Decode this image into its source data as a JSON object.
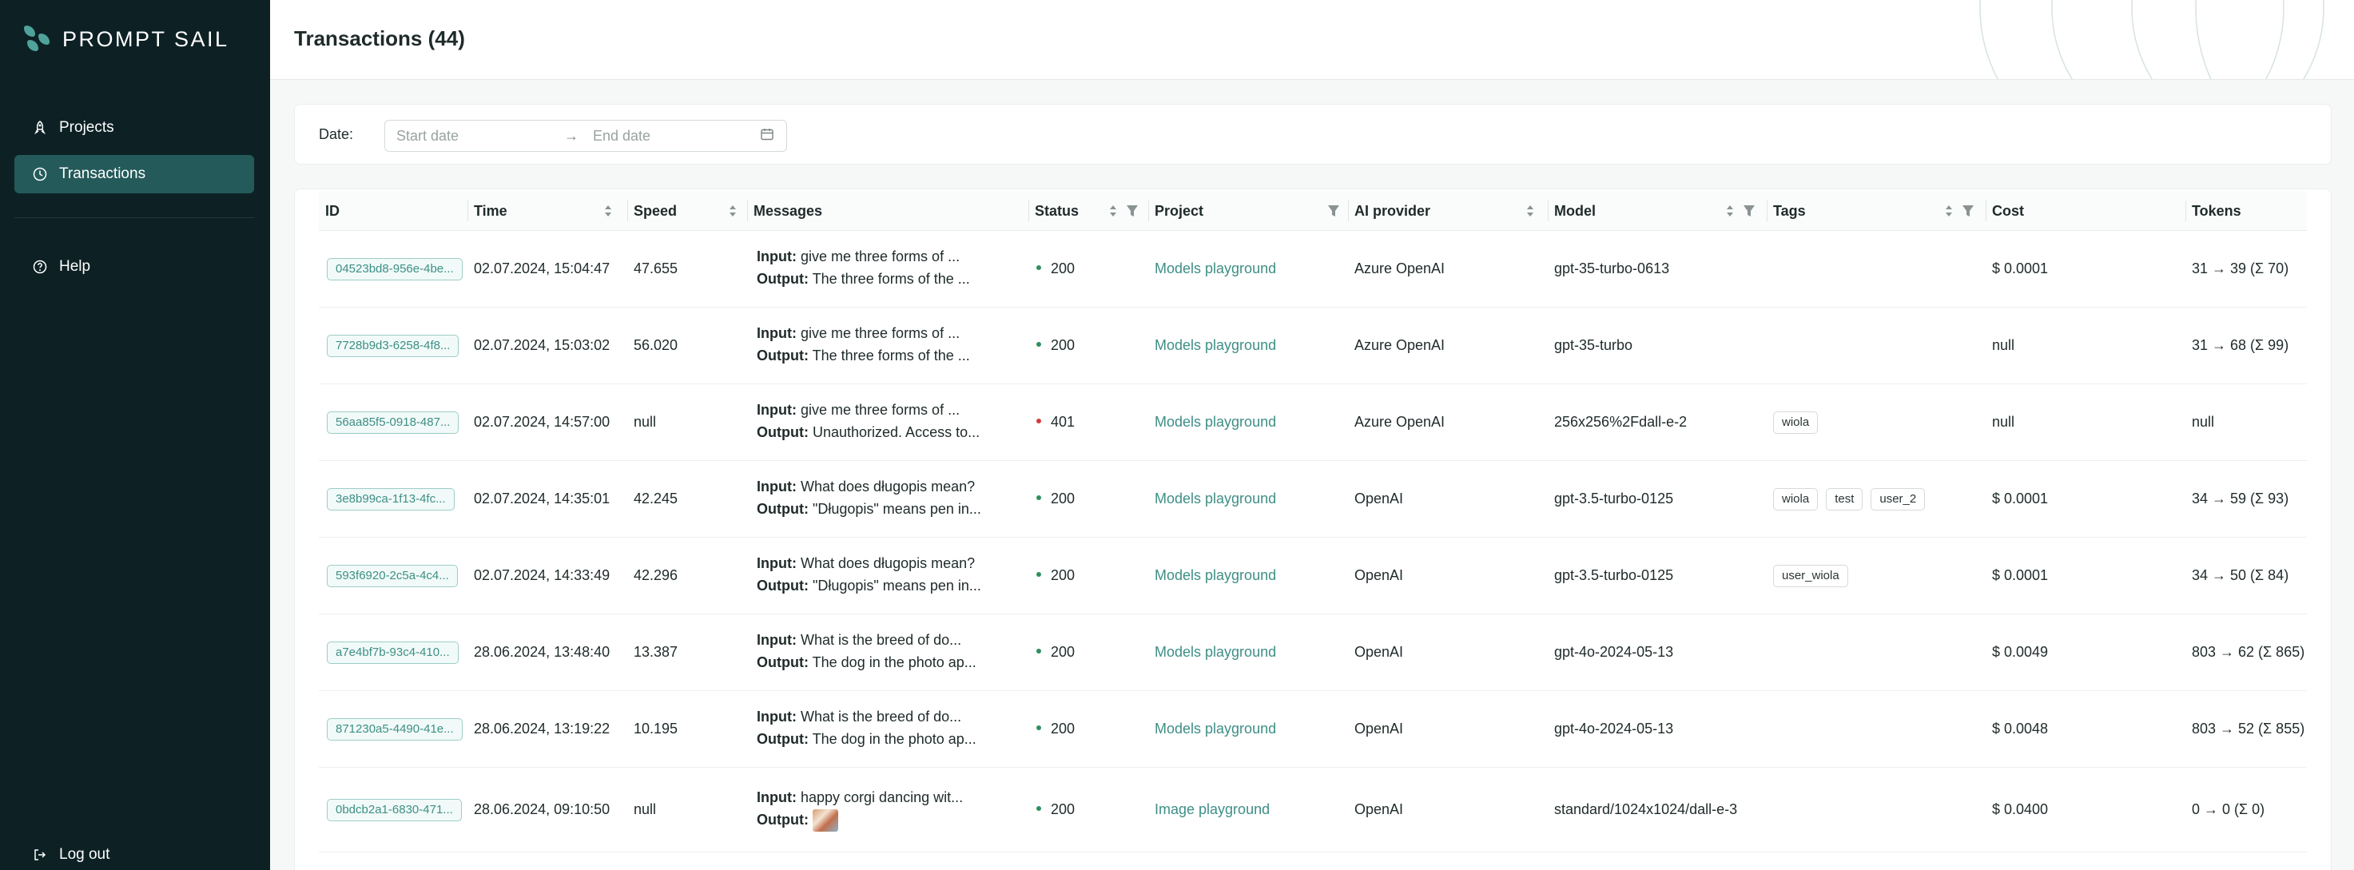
{
  "app": {
    "name": "PROMPT SAIL"
  },
  "sidebar": {
    "items": [
      {
        "label": "Projects",
        "icon": "rocket-icon",
        "active": false
      },
      {
        "label": "Transactions",
        "icon": "history-icon",
        "active": true
      },
      {
        "label": "Help",
        "icon": "question-circle-icon",
        "active": false
      }
    ],
    "logout": {
      "label": "Log out",
      "icon": "logout-icon"
    }
  },
  "header": {
    "title": "Transactions (44)"
  },
  "filters": {
    "date_label": "Date:",
    "start_placeholder": "Start date",
    "end_placeholder": "End date",
    "arrow": "→"
  },
  "table": {
    "columns": [
      "ID",
      "Time",
      "Speed",
      "Messages",
      "Status",
      "Project",
      "AI provider",
      "Model",
      "Tags",
      "Cost",
      "Tokens"
    ],
    "input_label": "Input:",
    "output_label": "Output:",
    "rows": [
      {
        "id": "04523bd8-956e-4be...",
        "time": "02.07.2024, 15:04:47",
        "speed": "47.655",
        "input": "give me three forms of ...",
        "output": "The three forms of the ...",
        "status": "200",
        "project": "Models playground",
        "provider": "Azure OpenAI",
        "model": "gpt-35-turbo-0613",
        "tags": [],
        "cost": "$ 0.0001",
        "tokens": "31 → 39 (Σ 70)"
      },
      {
        "id": "7728b9d3-6258-4f8...",
        "time": "02.07.2024, 15:03:02",
        "speed": "56.020",
        "input": "give me three forms of ...",
        "output": "The three forms of the ...",
        "status": "200",
        "project": "Models playground",
        "provider": "Azure OpenAI",
        "model": "gpt-35-turbo",
        "tags": [],
        "cost": "null",
        "tokens": "31 → 68 (Σ 99)"
      },
      {
        "id": "56aa85f5-0918-487...",
        "time": "02.07.2024, 14:57:00",
        "speed": "null",
        "input": "give me three forms of ...",
        "output": "Unauthorized. Access to...",
        "status": "401",
        "project": "Models playground",
        "provider": "Azure OpenAI",
        "model": "256x256%2Fdall-e-2",
        "tags": [
          "wiola"
        ],
        "cost": "null",
        "tokens": "null"
      },
      {
        "id": "3e8b99ca-1f13-4fc...",
        "time": "02.07.2024, 14:35:01",
        "speed": "42.245",
        "input": "What does długopis mean?",
        "output": "\"Długopis\" means pen in...",
        "status": "200",
        "project": "Models playground",
        "provider": "OpenAI",
        "model": "gpt-3.5-turbo-0125",
        "tags": [
          "wiola",
          "test",
          "user_2"
        ],
        "cost": "$ 0.0001",
        "tokens": "34 → 59 (Σ 93)"
      },
      {
        "id": "593f6920-2c5a-4c4...",
        "time": "02.07.2024, 14:33:49",
        "speed": "42.296",
        "input": "What does długopis mean?",
        "output": "\"Długopis\" means pen in...",
        "status": "200",
        "project": "Models playground",
        "provider": "OpenAI",
        "model": "gpt-3.5-turbo-0125",
        "tags": [
          "user_wiola"
        ],
        "cost": "$ 0.0001",
        "tokens": "34 → 50 (Σ 84)"
      },
      {
        "id": "a7e4bf7b-93c4-410...",
        "time": "28.06.2024, 13:48:40",
        "speed": "13.387",
        "input": "What is the breed of do...",
        "output": "The dog in the photo ap...",
        "status": "200",
        "project": "Models playground",
        "provider": "OpenAI",
        "model": "gpt-4o-2024-05-13",
        "tags": [],
        "cost": "$ 0.0049",
        "tokens": "803 → 62 (Σ 865)"
      },
      {
        "id": "871230a5-4490-41e...",
        "time": "28.06.2024, 13:19:22",
        "speed": "10.195",
        "input": "What is the breed of do...",
        "output": "The dog in the photo ap...",
        "status": "200",
        "project": "Models playground",
        "provider": "OpenAI",
        "model": "gpt-4o-2024-05-13",
        "tags": [],
        "cost": "$ 0.0048",
        "tokens": "803 → 52 (Σ 855)"
      },
      {
        "id": "0bdcb2a1-6830-471...",
        "time": "28.06.2024, 09:10:50",
        "speed": "null",
        "input": "happy corgi dancing wit...",
        "output": "",
        "output_image": true,
        "status": "200",
        "project": "Image playground",
        "provider": "OpenAI",
        "model": "standard/1024x1024/dall-e-3",
        "tags": [],
        "cost": "$ 0.0400",
        "tokens": "0 → 0 (Σ 0)"
      }
    ]
  },
  "colors": {
    "sidebar_bg": "#0d2125",
    "active_item": "#245a5a",
    "accent": "#3e8f86",
    "status_ok": "#2f8f5f",
    "status_error": "#d23c3c"
  }
}
